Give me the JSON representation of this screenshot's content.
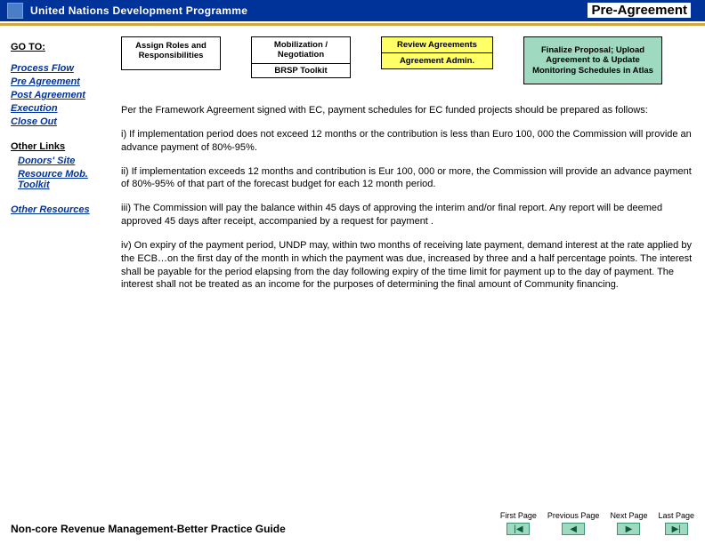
{
  "header": {
    "org": "United Nations Development Programme",
    "page_title": "Pre-Agreement"
  },
  "sidebar": {
    "goto": "GO TO:",
    "nav": [
      "Process Flow",
      "Pre Agreement",
      "Post Agreement",
      "Execution",
      "Close Out"
    ],
    "other_label": "Other Links",
    "other": [
      "Donors' Site",
      "Resource Mob. Toolkit"
    ],
    "other_resources": "Other Resources"
  },
  "flow": {
    "box1": "Assign Roles and Responsibilities",
    "box2_top": "Mobilization / Negotiation",
    "box2_bot": "BRSP Toolkit",
    "box3_top": "Review Agreements",
    "box3_bot": "Agreement Admin.",
    "box4": "Finalize Proposal; Upload Agreement to & Update Monitoring Schedules in Atlas"
  },
  "body": {
    "p1": "Per the Framework Agreement signed with EC, payment schedules for EC funded projects should be prepared as follows:",
    "p2": "i)  If implementation period does not exceed 12 months or the contribution is less than Euro 100, 000 the Commission will provide an advance payment of 80%-95%.",
    "p3": "ii) If implementation exceeds 12 months and contribution is Eur 100, 000 or more, the Commission will provide an advance payment of 80%-95% of that part of the forecast budget for each 12 month period.",
    "p4": "iii)  The Commission will pay the balance within 45 days of approving the interim and/or final report.  Any report will be deemed approved 45 days after receipt, accompanied  by a request for payment .",
    "p5": "iv)  On expiry of the payment period, UNDP may, within two months of receiving late payment, demand interest at the rate applied by the ECB…on the first day of the month in which the payment was due, increased by three and a half percentage points. The interest shall be payable for the period elapsing from the day following expiry of the time limit for payment up to the day of payment. The interest shall not be treated as an income for the purposes of determining the final amount of Community financing."
  },
  "footer": {
    "title": "Non-core Revenue Management-Better Practice Guide",
    "btns": [
      "First Page",
      "Previous Page",
      "Next Page",
      "Last Page"
    ],
    "icons": [
      "|◀",
      "◀",
      "▶",
      "▶|"
    ]
  }
}
